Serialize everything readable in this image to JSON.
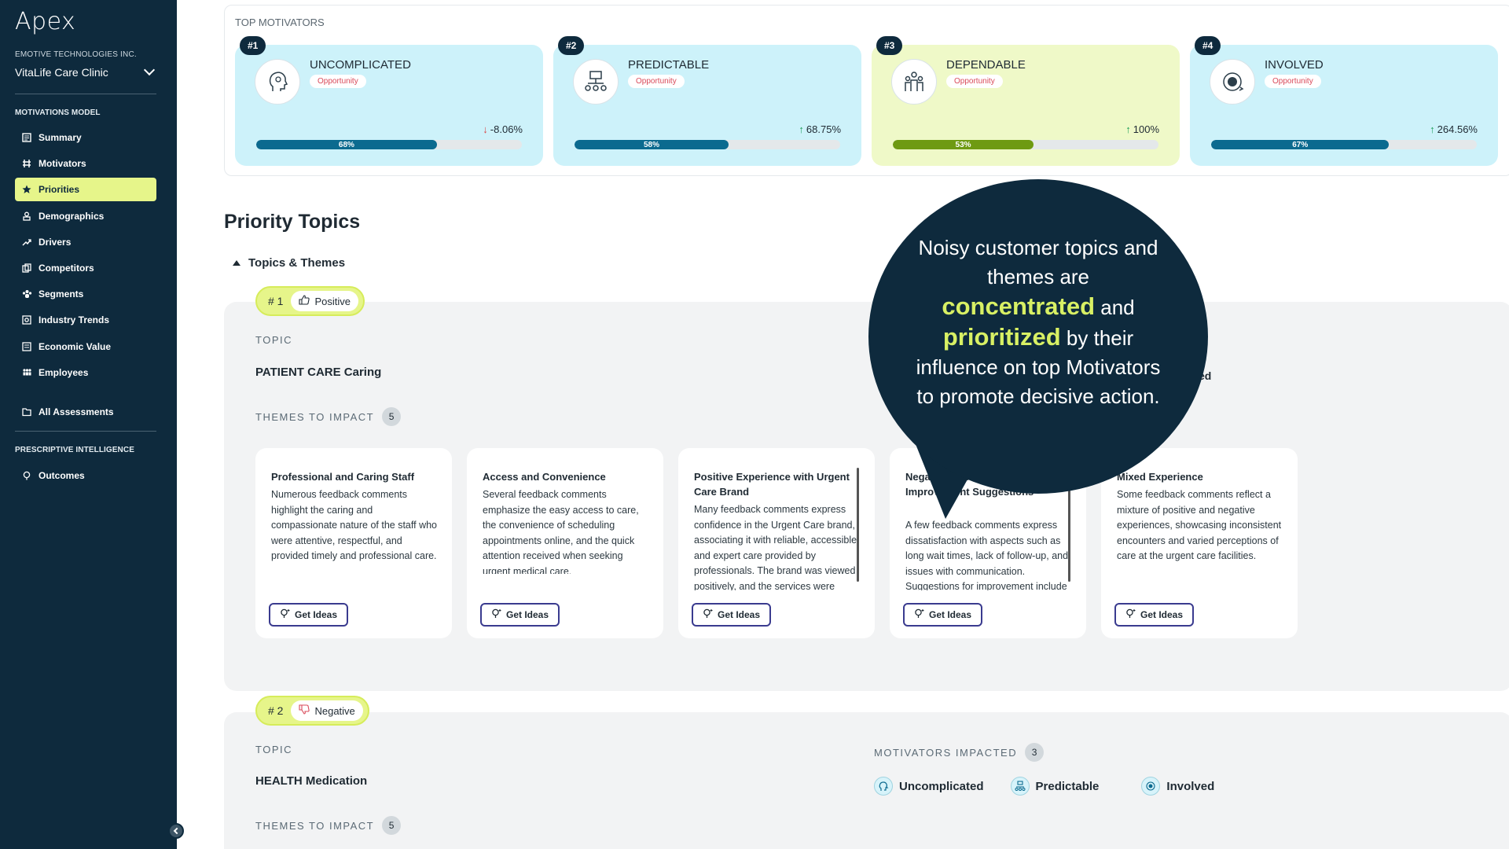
{
  "sidebar": {
    "logo": "Apex",
    "company": "EMOTIVE TECHNOLOGIES INC.",
    "clinic": "VitaLife Care Clinic",
    "section_model": "MOTIVATIONS MODEL",
    "items": [
      {
        "label": "Summary",
        "icon": "summary-icon"
      },
      {
        "label": "Motivators",
        "icon": "motivators-icon"
      },
      {
        "label": "Priorities",
        "icon": "star-icon"
      },
      {
        "label": "Demographics",
        "icon": "demographics-icon"
      },
      {
        "label": "Drivers",
        "icon": "trend-icon"
      },
      {
        "label": "Competitors",
        "icon": "competitors-icon"
      },
      {
        "label": "Segments",
        "icon": "segments-icon"
      },
      {
        "label": "Industry Trends",
        "icon": "industry-icon"
      },
      {
        "label": "Economic Value",
        "icon": "economic-icon"
      },
      {
        "label": "Employees",
        "icon": "employees-icon"
      }
    ],
    "all_assessments": "All Assessments",
    "section_prescriptive": "PRESCRIPTIVE INTELLIGENCE",
    "outcomes": "Outcomes"
  },
  "top_motivators": {
    "label": "TOP MOTIVATORS",
    "cards": [
      {
        "rank": "#1",
        "title": "UNCOMPLICATED",
        "tag": "Opportunity",
        "change": "-8.06%",
        "direction": "down",
        "percent_label": "68%",
        "fill": 0.68,
        "color": "#cdf2fa"
      },
      {
        "rank": "#2",
        "title": "PREDICTABLE",
        "tag": "Opportunity",
        "change": "68.75%",
        "direction": "up",
        "percent_label": "58%",
        "fill": 0.58,
        "color": "#cdf2fa"
      },
      {
        "rank": "#3",
        "title": "DEPENDABLE",
        "tag": "Opportunity",
        "change": "100%",
        "direction": "up",
        "percent_label": "53%",
        "fill": 0.53,
        "color": "#eff9c8"
      },
      {
        "rank": "#4",
        "title": "INVOLVED",
        "tag": "Opportunity",
        "change": "264.56%",
        "direction": "up",
        "percent_label": "67%",
        "fill": 0.67,
        "color": "#cdf2fa"
      }
    ]
  },
  "priority": {
    "heading": "Priority Topics",
    "toggle": "Topics & Themes",
    "topic1": {
      "rank": "# 1",
      "sentiment": "Positive",
      "topic_caption": "TOPIC",
      "topic_name": "PATIENT CARE Caring",
      "partial_text": "ed",
      "themes_caption": "THEMES TO IMPACT",
      "themes_count": "5",
      "themes": [
        {
          "title": "Professional and Caring Staff",
          "body": "Numerous feedback comments highlight the caring and compassionate nature of the staff who were attentive, respectful, and provided timely and professional care.",
          "button": "Get Ideas"
        },
        {
          "title": "Access and Convenience",
          "body": "Several feedback comments emphasize the easy access to care, the convenience of scheduling appointments online, and the quick attention received when seeking urgent medical care.",
          "button": "Get Ideas"
        },
        {
          "title": "Positive Experience with Urgent Care Brand",
          "body": "Many feedback comments express confidence in the Urgent Care brand, associating it with reliable, accessible, and expert care provided by professionals. The brand was viewed positively, and the services were deemed",
          "button": "Get Ideas"
        },
        {
          "title": "Negative Experience, Improvement Suggestions",
          "body": "A few feedback comments express dissatisfaction with aspects such as long wait times, lack of follow-up, and issues with communication. Suggestions for improvement include enhanced",
          "button": "Get Ideas"
        },
        {
          "title": "Mixed Experience",
          "body": "Some feedback comments reflect a mixture of positive and negative experiences, showcasing inconsistent encounters and varied perceptions of care at the urgent care facilities.",
          "button": "Get Ideas"
        }
      ]
    },
    "topic2": {
      "rank": "# 2",
      "sentiment": "Negative",
      "topic_caption": "TOPIC",
      "topic_name": "HEALTH Medication",
      "motivators_caption": "MOTIVATORS IMPACTED",
      "motivators_count": "3",
      "motivators": [
        "Uncomplicated",
        "Predictable",
        "Involved"
      ],
      "themes_caption": "THEMES TO IMPACT",
      "themes_count": "5"
    }
  },
  "callout": {
    "line1": "Noisy customer topics and themes are",
    "hl1": "concentrated",
    "mid": "and",
    "hl2": "prioritized",
    "line2": "by their influence on top Motivators to promote decisive action."
  }
}
